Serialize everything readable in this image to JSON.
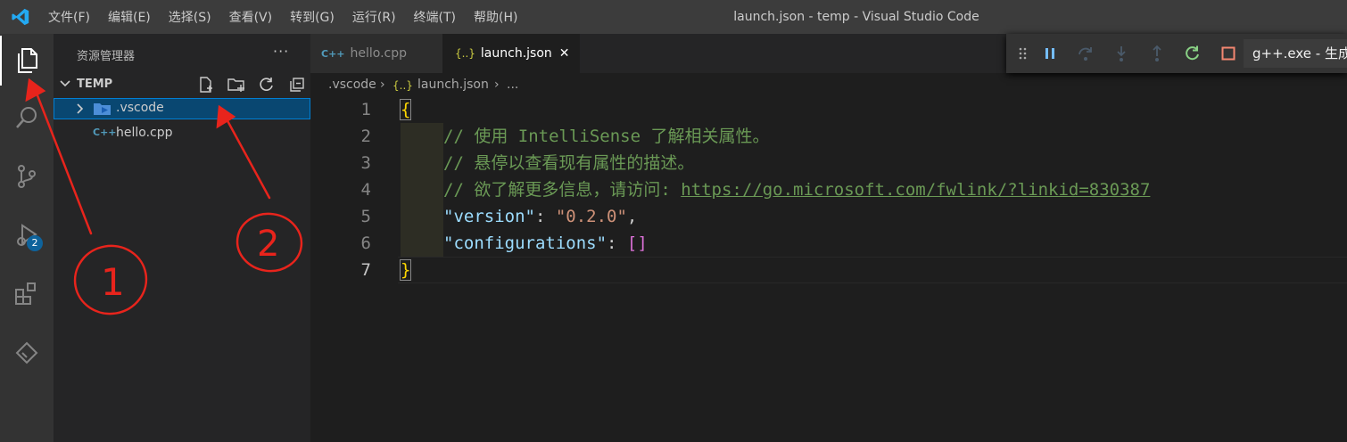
{
  "menu": [
    "文件(F)",
    "编辑(E)",
    "选择(S)",
    "查看(V)",
    "转到(G)",
    "运行(R)",
    "终端(T)",
    "帮助(H)"
  ],
  "window_title": "launch.json - temp - Visual Studio Code",
  "activity": {
    "debug_badge": "2"
  },
  "sidebar": {
    "title": "资源管理器",
    "more": "···",
    "section": "TEMP",
    "tree": [
      {
        "label": ".vscode",
        "type": "folder"
      },
      {
        "label": "hello.cpp",
        "type": "file"
      }
    ]
  },
  "tabs": [
    {
      "label": "hello.cpp",
      "icon": "C++"
    },
    {
      "label": "launch.json",
      "icon": "{..}",
      "close": "✕"
    }
  ],
  "debug": {
    "config": "g++.exe - 生成"
  },
  "breadcrumb": [
    ".vscode",
    "›",
    "{..}",
    "launch.json",
    "›",
    "..."
  ],
  "code": {
    "line_numbers": [
      "1",
      "2",
      "3",
      "4",
      "5",
      "6",
      "7"
    ],
    "open_brace": "{",
    "c2": "// 使用 IntelliSense 了解相关属性。",
    "c3": "// 悬停以查看现有属性的描述。",
    "c4": "// 欲了解更多信息，请访问: ",
    "c4_url": "https://go.microsoft.com/fwlink/?linkid=830387",
    "k5": "\"version\"",
    "colon": ": ",
    "v5": "\"0.2.0\"",
    "comma": ",",
    "k6": "\"configurations\"",
    "v6": "[]",
    "close_brace": "}"
  },
  "annotations": {
    "one": "1",
    "two": "2"
  }
}
